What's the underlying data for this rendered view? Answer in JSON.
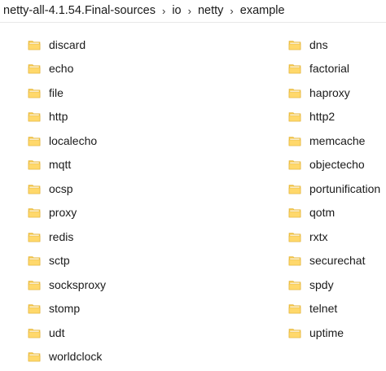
{
  "breadcrumb": {
    "items": [
      "netty-all-4.1.54.Final-sources",
      "io",
      "netty",
      "example"
    ]
  },
  "colors": {
    "folder_body": "#F5C84C",
    "folder_front": "#FFD86B",
    "folder_edge": "#E0AE2E",
    "paper": "#FFFFFF"
  },
  "folders": {
    "left": [
      {
        "name": "discard",
        "icon": "folder-icon"
      },
      {
        "name": "echo",
        "icon": "folder-icon"
      },
      {
        "name": "file",
        "icon": "folder-icon"
      },
      {
        "name": "http",
        "icon": "folder-icon"
      },
      {
        "name": "localecho",
        "icon": "folder-icon"
      },
      {
        "name": "mqtt",
        "icon": "folder-icon"
      },
      {
        "name": "ocsp",
        "icon": "folder-icon"
      },
      {
        "name": "proxy",
        "icon": "folder-icon"
      },
      {
        "name": "redis",
        "icon": "folder-icon"
      },
      {
        "name": "sctp",
        "icon": "folder-icon"
      },
      {
        "name": "socksproxy",
        "icon": "folder-icon"
      },
      {
        "name": "stomp",
        "icon": "folder-icon"
      },
      {
        "name": "udt",
        "icon": "folder-icon"
      },
      {
        "name": "worldclock",
        "icon": "folder-icon"
      }
    ],
    "right": [
      {
        "name": "dns",
        "icon": "folder-icon"
      },
      {
        "name": "factorial",
        "icon": "folder-icon"
      },
      {
        "name": "haproxy",
        "icon": "folder-icon"
      },
      {
        "name": "http2",
        "icon": "folder-icon"
      },
      {
        "name": "memcache",
        "icon": "folder-icon"
      },
      {
        "name": "objectecho",
        "icon": "folder-icon"
      },
      {
        "name": "portunification",
        "icon": "folder-icon"
      },
      {
        "name": "qotm",
        "icon": "folder-icon"
      },
      {
        "name": "rxtx",
        "icon": "folder-icon"
      },
      {
        "name": "securechat",
        "icon": "folder-icon"
      },
      {
        "name": "spdy",
        "icon": "folder-icon"
      },
      {
        "name": "telnet",
        "icon": "folder-icon"
      },
      {
        "name": "uptime",
        "icon": "folder-icon"
      }
    ]
  }
}
